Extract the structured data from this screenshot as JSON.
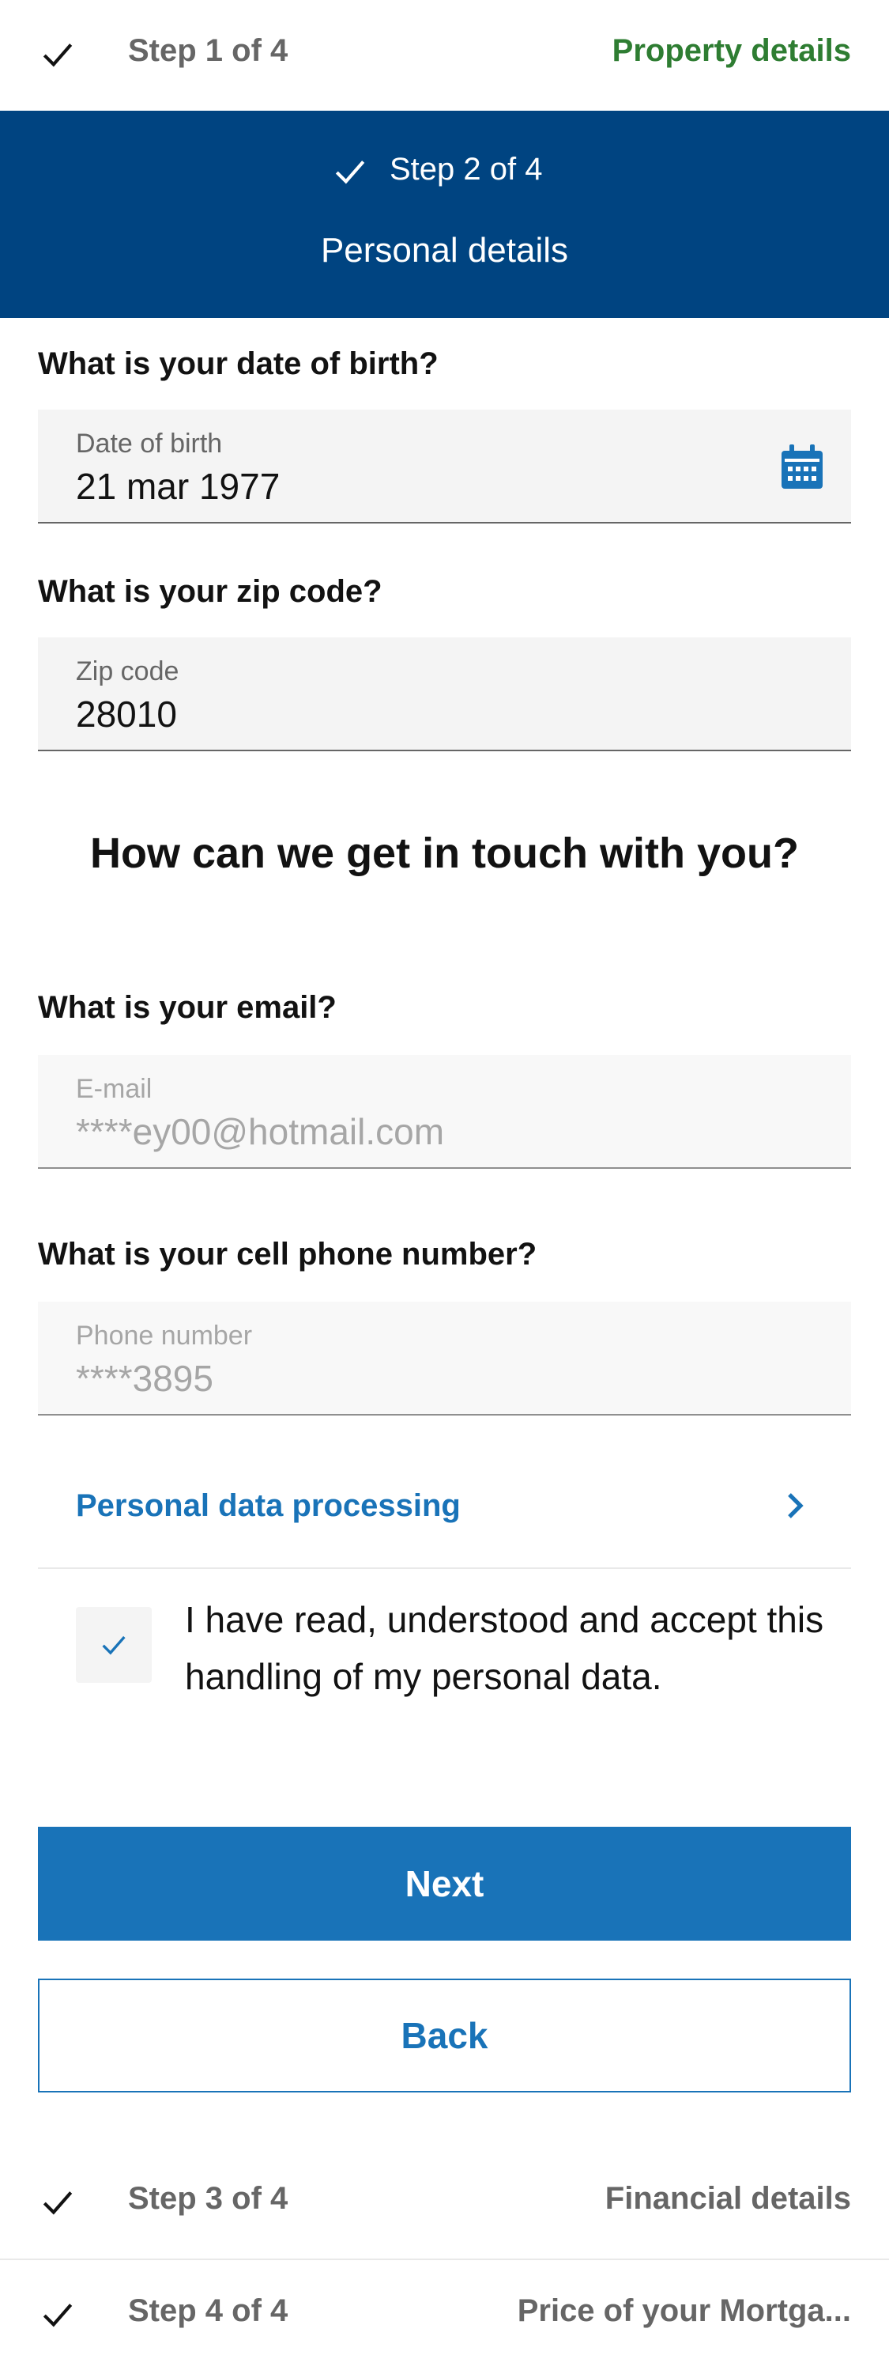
{
  "steps": {
    "step1": {
      "label": "Step 1 of 4",
      "title": "Property details"
    },
    "step2": {
      "label": "Step 2 of 4",
      "title": "Personal details"
    },
    "step3": {
      "label": "Step 3 of 4",
      "title": "Financial details"
    },
    "step4": {
      "label": "Step 4 of 4",
      "title": "Price of your Mortga..."
    }
  },
  "form": {
    "dob": {
      "question": "What is your date of birth?",
      "label": "Date of birth",
      "value": "21 mar 1977",
      "icon": "calendar-icon"
    },
    "zip": {
      "question": "What is your zip code?",
      "label": "Zip code",
      "value": "28010"
    },
    "contact_title": "How can we get in touch with you?",
    "email": {
      "question": "What is your email?",
      "label": "E-mail",
      "value": "****ey00@hotmail.com"
    },
    "phone": {
      "question": "What is your cell phone number?",
      "label": "Phone number",
      "value": "****3895"
    }
  },
  "privacy": {
    "link_label": "Personal data processing",
    "consent_text": "I have read, understood and accept this handling of my personal data.",
    "consent_checked": true
  },
  "buttons": {
    "next": "Next",
    "back": "Back"
  },
  "colors": {
    "header_bg": "#004481",
    "primary": "#1973b8",
    "done_green": "#2e7d32"
  }
}
